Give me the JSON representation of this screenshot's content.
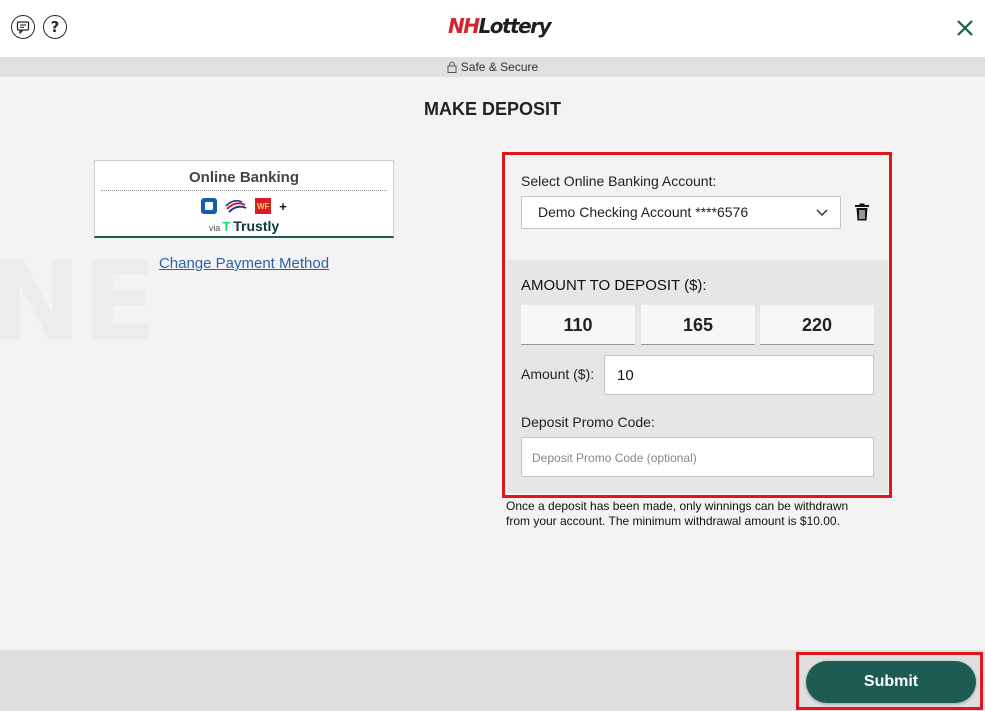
{
  "header": {
    "logo_nh": "NH",
    "logo_lottery": "Lottery",
    "chat_icon": "chat-icon",
    "help_icon": "?",
    "close_icon": "close-icon"
  },
  "secure_bar": {
    "label": "Safe & Secure",
    "icon": "lock-icon"
  },
  "page": {
    "title": "MAKE DEPOSIT"
  },
  "payment_method": {
    "title": "Online Banking",
    "banks": [
      "chase-icon",
      "bank-of-america-icon",
      "wells-fargo-icon"
    ],
    "plus": "+",
    "via": "via",
    "provider": "Trustly",
    "change_link": "Change Payment Method"
  },
  "account": {
    "label": "Select Online Banking Account:",
    "selected": "Demo Checking Account ****6576"
  },
  "amount": {
    "title": "AMOUNT TO DEPOSIT ($):",
    "quick_amounts": [
      "110",
      "165",
      "220"
    ],
    "label": "Amount ($):",
    "value": "10"
  },
  "promo": {
    "label": "Deposit Promo Code:",
    "placeholder": "Deposit Promo Code (optional)"
  },
  "note": "Once a deposit has been made, only winnings can be withdrawn from your account. The minimum withdrawal amount is $10.00.",
  "footer": {
    "submit_label": "Submit"
  },
  "colors": {
    "accent": "#1e5b52",
    "highlight": "#e0161f",
    "link": "#2c62a5"
  }
}
